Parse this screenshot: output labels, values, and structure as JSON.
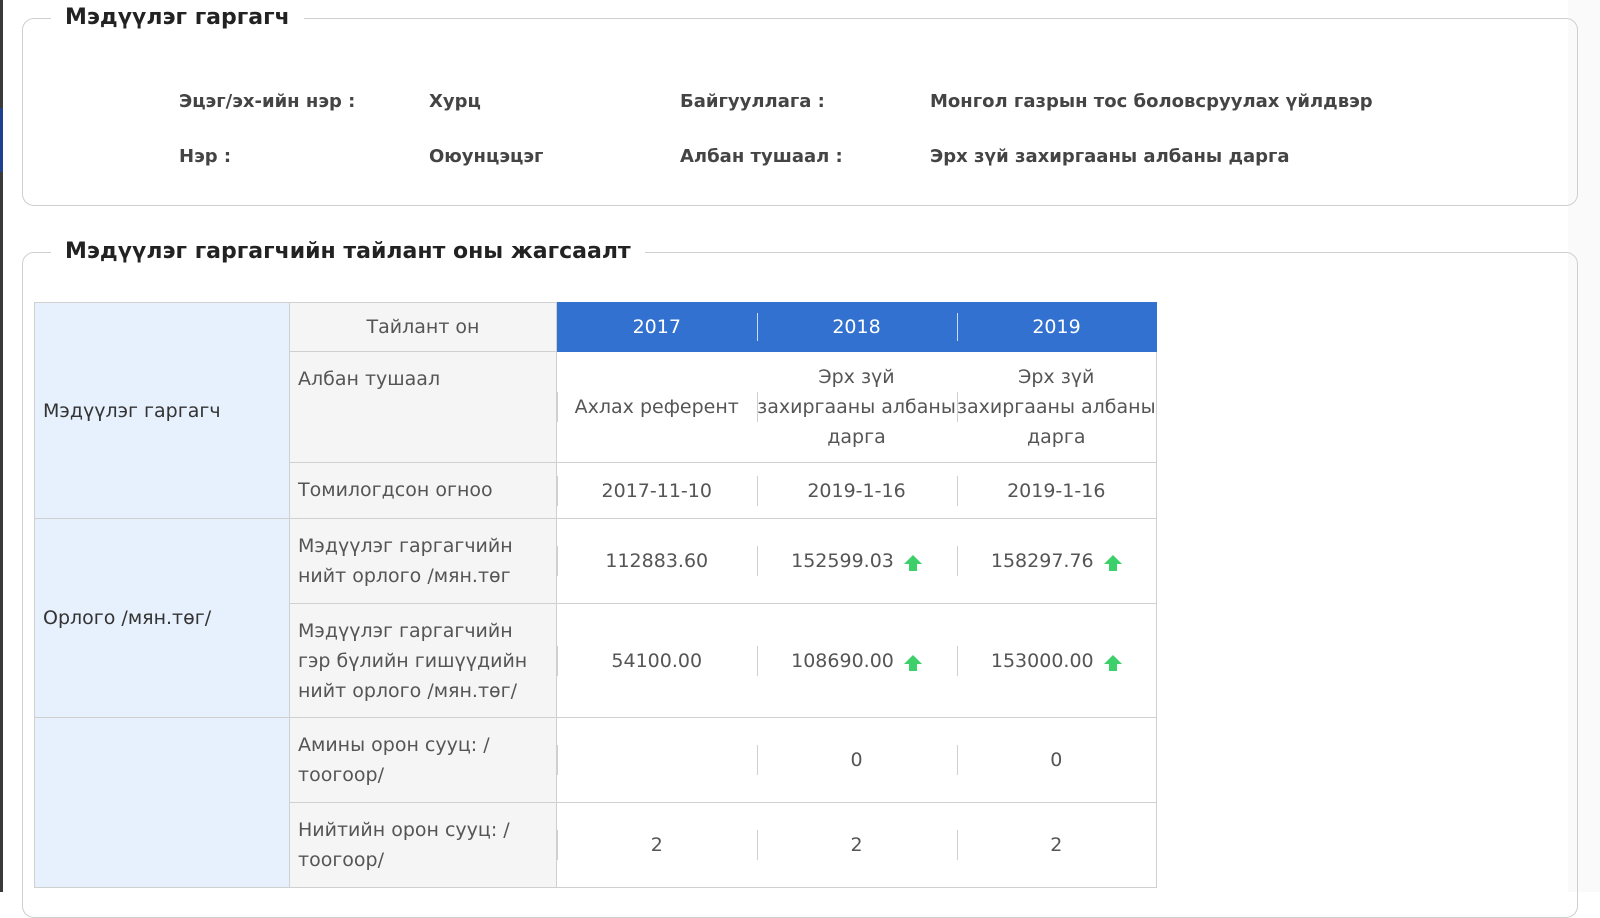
{
  "declarant_section": {
    "title": "Мэдүүлэг гаргагч",
    "fields": [
      {
        "label": "Эцэг/эх-ийн нэр :",
        "value": "Хурц"
      },
      {
        "label": "Нэр :",
        "value": "Оюунцэцэг"
      },
      {
        "label": "Байгууллага :",
        "value": "Монгол газрын тос боловсруулах үйлдвэр"
      },
      {
        "label": "Албан тушаал :",
        "value": "Эрх зүй захиргааны албаны дарга"
      }
    ]
  },
  "summary_section": {
    "title": "Мэдүүлэг гаргагчийн тайлант оны жагсаалт",
    "year_header_label": "Тайлант он",
    "years": [
      "2017",
      "2018",
      "2019"
    ],
    "groups": [
      {
        "category": "Мэдүүлэг гаргагч",
        "rows": [
          {
            "label": "Албан тушаал",
            "values": [
              "Ахлах референт",
              "Эрх зүй захиргааны албаны дарга",
              "Эрх зүй захиргааны албаны дарга"
            ],
            "up": [
              false,
              false,
              false
            ]
          },
          {
            "label": "Томилогдсон огноо",
            "values": [
              "2017-11-10",
              "2019-1-16",
              "2019-1-16"
            ],
            "up": [
              false,
              false,
              false
            ]
          }
        ]
      },
      {
        "category": "Орлого /мян.төг/",
        "rows": [
          {
            "label": "Мэдүүлэг гаргагчийн нийт орлого /мян.төг",
            "values": [
              "112883.60",
              "152599.03",
              "158297.76"
            ],
            "up": [
              false,
              true,
              true
            ]
          },
          {
            "label": "Мэдүүлэг гаргагчийн гэр бүлийн гишүүдийн нийт орлого /мян.төг/",
            "values": [
              "54100.00",
              "108690.00",
              "153000.00"
            ],
            "up": [
              false,
              true,
              true
            ]
          }
        ]
      },
      {
        "category": "",
        "rows": [
          {
            "label": "Амины орон сууц: /тоогоор/",
            "values": [
              "",
              "0",
              "0"
            ],
            "up": [
              false,
              false,
              false
            ]
          },
          {
            "label": "Нийтийн орон сууц: /тоогоор/",
            "values": [
              "2",
              "2",
              "2"
            ],
            "up": [
              false,
              false,
              false
            ]
          }
        ]
      }
    ]
  },
  "colors": {
    "year_header_bg": "#3271d0",
    "category_bg": "#e7f0fd",
    "increase_arrow": "#3ccf6a"
  },
  "icons": {
    "increase": "arrow-up-icon"
  }
}
